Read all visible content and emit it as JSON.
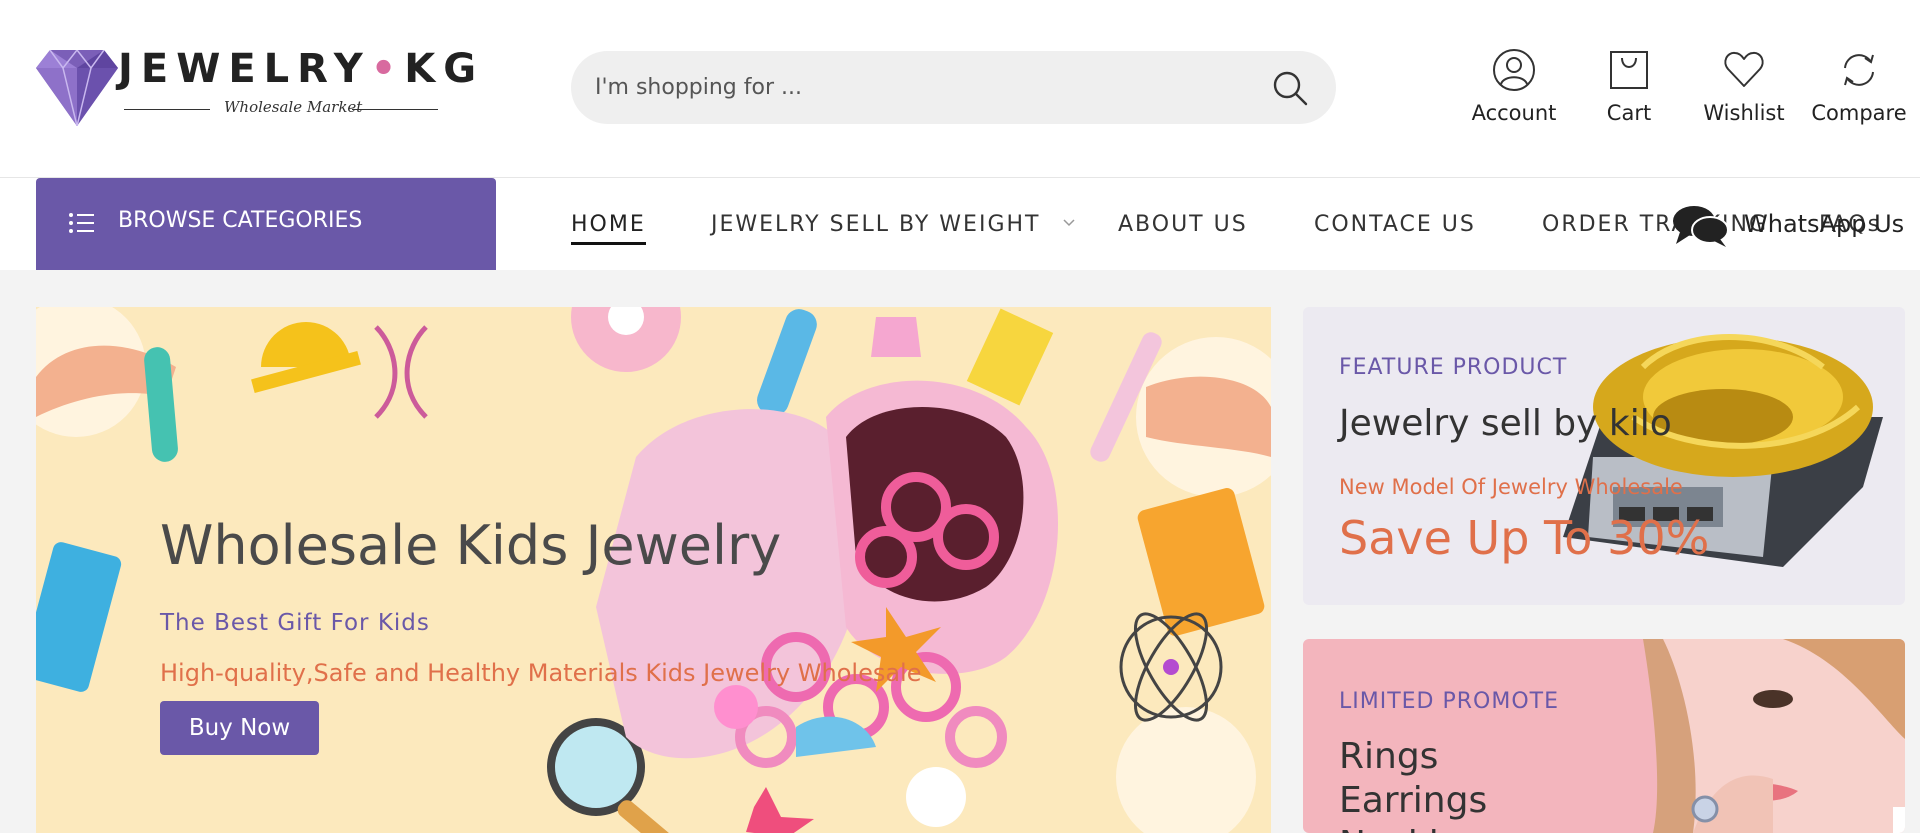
{
  "brand": {
    "name_left": "JEWELRY",
    "name_dot": "•",
    "name_right": "KG",
    "tagline": "Wholesale Market"
  },
  "search": {
    "placeholder": "I'm shopping for ..."
  },
  "header_actions": [
    {
      "label": "Account",
      "icon": "user-icon"
    },
    {
      "label": "Cart",
      "icon": "bag-icon"
    },
    {
      "label": "Wishlist",
      "icon": "heart-icon"
    },
    {
      "label": "Compare",
      "icon": "refresh-icon"
    }
  ],
  "browse": {
    "label": "BROWSE CATEGORIES"
  },
  "nav": {
    "home": "HOME",
    "weight": "JEWELRY SELL BY WEIGHT",
    "about": "ABOUT US",
    "contact": "CONTACE US",
    "tracking": "ORDER TRACKING",
    "faqs": "FAQs"
  },
  "whatsapp": {
    "label": "WhatsApp Us"
  },
  "hero": {
    "title": "Wholesale Kids Jewelry",
    "subtitle": "The Best Gift For Kids",
    "description": "High-quality,Safe and Healthy Materials Kids Jewelry Wholesale",
    "button": "Buy Now"
  },
  "feature_card": {
    "kicker": "FEATURE PRODUCT",
    "title": "Jewelry sell by kilo",
    "subtitle": "New Model Of Jewelry Wholesale",
    "promo": "Save Up To 30%"
  },
  "promote_card": {
    "kicker": "LIMITED PROMOTE",
    "items": [
      "Rings",
      "Earrings",
      "Necklaces"
    ]
  },
  "colors": {
    "accent": "#6a58a8",
    "orange": "#e0704a",
    "hero_bg": "#fce9bd",
    "card_pink": "#f3b5bd"
  }
}
